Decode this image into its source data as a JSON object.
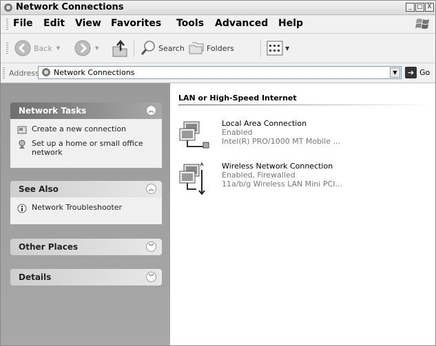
{
  "window": {
    "title": "Network Connections",
    "controls": [
      "_",
      "□",
      "X"
    ]
  },
  "menu": {
    "file": "File",
    "edit": "Edit",
    "view": "View",
    "favorites": "Favorites",
    "tools": "Tools",
    "advanced": "Advanced",
    "help": "Help"
  },
  "toolbar": {
    "back": "Back",
    "search": "Search",
    "folders": "Folders"
  },
  "address": {
    "label": "Address",
    "value": "Network Connections",
    "go": "Go"
  },
  "taskpane": {
    "network_tasks": {
      "title": "Network Tasks",
      "items": [
        {
          "label": "Create a new connection"
        },
        {
          "label": "Set up a home or small office network"
        }
      ]
    },
    "see_also": {
      "title": "See Also",
      "items": [
        {
          "label": "Network Troubleshooter"
        }
      ]
    },
    "other_places": {
      "title": "Other Places"
    },
    "details": {
      "title": "Details"
    }
  },
  "content": {
    "group_title": "LAN or High-Speed Internet",
    "connections": [
      {
        "name": "Local Area Connection",
        "status": "Enabled",
        "device": "Intel(R) PRO/1000 MT Mobile ..."
      },
      {
        "name": "Wireless Network Connection",
        "status": "Enabled, Firewalled",
        "device": "11a/b/g Wireless LAN Mini PCI..."
      }
    ]
  },
  "colors": {
    "task_pane": "#a0a0a0",
    "panel_body": "#f0f0f0",
    "address_border": "#7f9db9"
  }
}
